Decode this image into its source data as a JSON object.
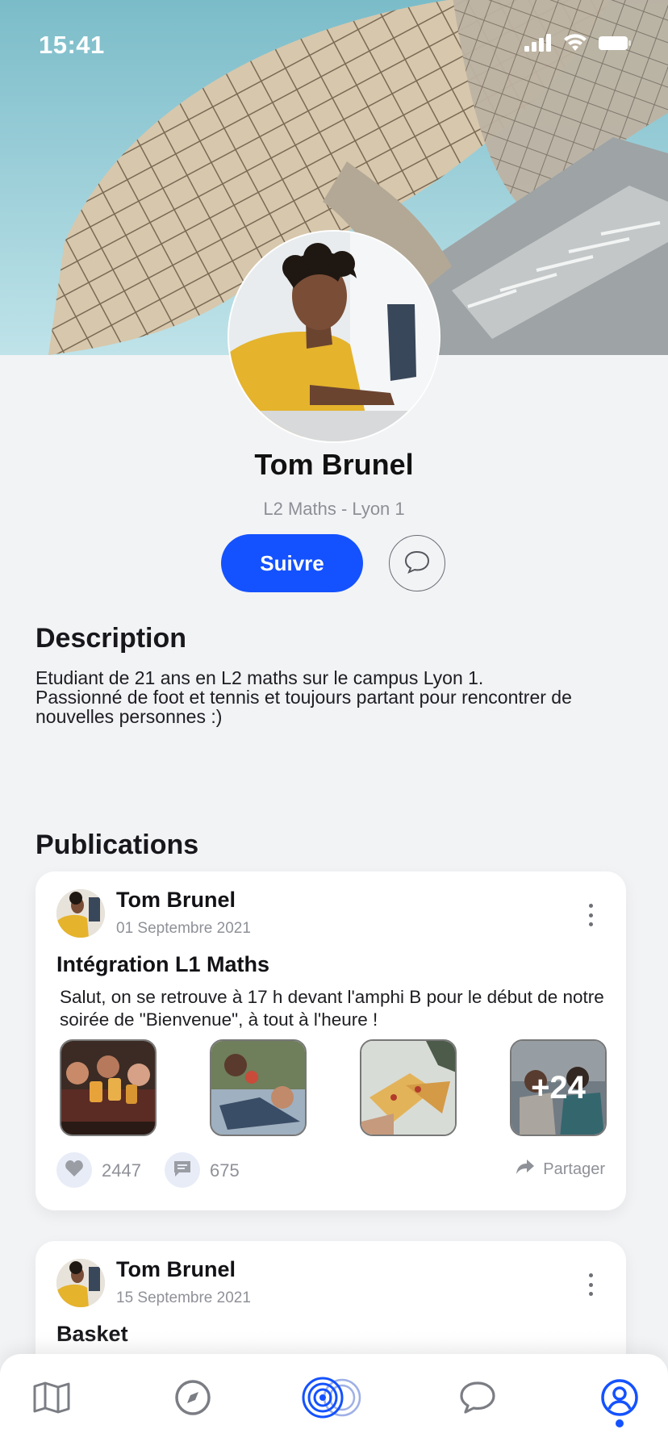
{
  "status_bar": {
    "time": "15:41"
  },
  "profile": {
    "name": "Tom Brunel",
    "subtitle": "L2 Maths - Lyon 1",
    "follow_label": "Suivre"
  },
  "description": {
    "title": "Description",
    "lines": [
      "Etudiant de 21 ans en L2 maths sur le campus Lyon 1.",
      "Passionné de foot et tennis et toujours partant pour rencontrer de",
      "nouvelles personnes :)"
    ]
  },
  "publications": {
    "title": "Publications",
    "posts": [
      {
        "author": "Tom Brunel",
        "date": "01 Septembre 2021",
        "title": "Intégration L1 Maths",
        "text": "Salut, on se retrouve à 17 h devant l'amphi B pour le début de notre soirée de \"Bienvenue\", à tout à l'heure !",
        "more_photos": "+24",
        "likes": "2447",
        "comments": "675",
        "share_label": "Partager"
      },
      {
        "author": "Tom Brunel",
        "date": "15 Septembre 2021",
        "title": "Basket"
      }
    ]
  },
  "nav": {
    "items": [
      "map-icon",
      "compass-icon",
      "radar-icon",
      "chat-icon",
      "profile-icon"
    ],
    "active": "profile-icon",
    "accent": "#1452ff"
  },
  "colors": {
    "accent": "#1452ff",
    "background": "#f2f3f5"
  }
}
